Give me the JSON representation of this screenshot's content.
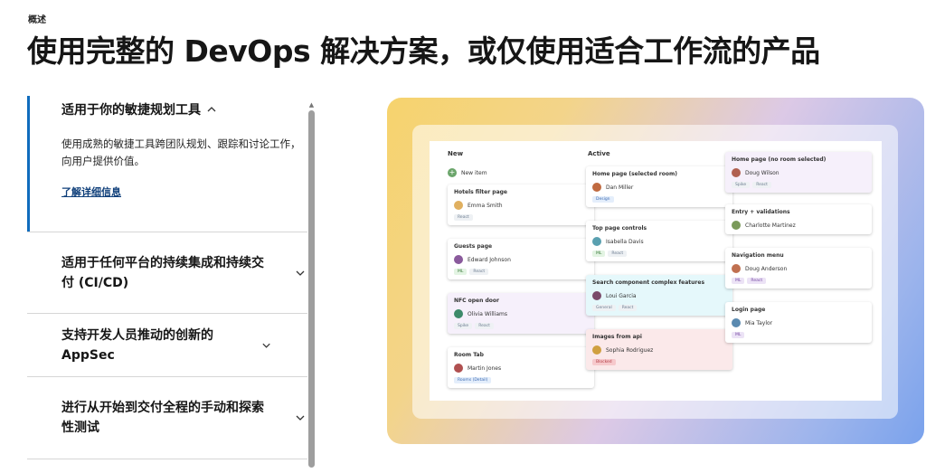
{
  "eyebrow": "概述",
  "headline": "使用完整的 DevOps 解决方案，或仅使用适合工作流的产品",
  "accordion": {
    "open": {
      "title": "适用于你的敏捷规划工具",
      "description": "使用成熟的敏捷工具跨团队规划、跟踪和讨论工作，向用户提供价值。",
      "link": "了解详细信息"
    },
    "items": [
      {
        "title": "适用于任何平台的持续集成和持续交付 (CI/CD)"
      },
      {
        "title": "支持开发人员推动的创新的 AppSec"
      },
      {
        "title": "进行从开始到交付全程的手动和探索性测试"
      }
    ]
  },
  "board": {
    "columns": [
      {
        "title": "New",
        "new_item": "New item"
      },
      {
        "title": "Active"
      },
      {
        "title": ""
      }
    ],
    "cards": {
      "new": [
        {
          "title": "Hotels filter page",
          "user": "Emma Smith",
          "tags": [
            "React"
          ],
          "avatar": "#e0b060"
        },
        {
          "title": "Guests page",
          "user": "Edward Johnson",
          "tags": [
            "ML",
            "React"
          ],
          "avatar": "#8a5a9c"
        },
        {
          "title": "NFC open door",
          "user": "Olivia Williams",
          "tags": [
            "Spike",
            "React"
          ],
          "avatar": "#3d8a6a"
        },
        {
          "title": "Room Tab",
          "user": "Martin Jones",
          "tags": [
            "Rooms (Detail)"
          ],
          "avatar": "#b05050"
        }
      ],
      "active": [
        {
          "title": "Home page (selected room)",
          "user": "Dan Miller",
          "tags": [
            "Design"
          ],
          "avatar": "#c06a40"
        },
        {
          "title": "Top page controls",
          "user": "Isabella Davis",
          "tags": [
            "ML",
            "React"
          ],
          "avatar": "#5aa0b0"
        },
        {
          "title": "Search component complex features",
          "user": "Loui Garcia",
          "tags": [
            "General",
            "React"
          ],
          "avatar": "#7a4a6a"
        },
        {
          "title": "Images from api",
          "user": "Sophia Rodriguez",
          "tags": [
            "Blocked"
          ],
          "avatar": "#d0a040"
        }
      ],
      "third": [
        {
          "title": "Home page (no room selected)",
          "user": "Doug Wilson",
          "tags": [
            "Spike",
            "React"
          ],
          "avatar": "#b06050"
        },
        {
          "title": "Entry + validations",
          "user": "Charlotte Martinez",
          "tags": [],
          "avatar": "#7a9a5a"
        },
        {
          "title": "Navigation menu",
          "user": "Doug Anderson",
          "tags": [
            "ML",
            "React"
          ],
          "avatar": "#c07050"
        },
        {
          "title": "Login page",
          "user": "Mia Taylor",
          "tags": [
            "ML"
          ],
          "avatar": "#5a8ab0"
        }
      ]
    }
  }
}
